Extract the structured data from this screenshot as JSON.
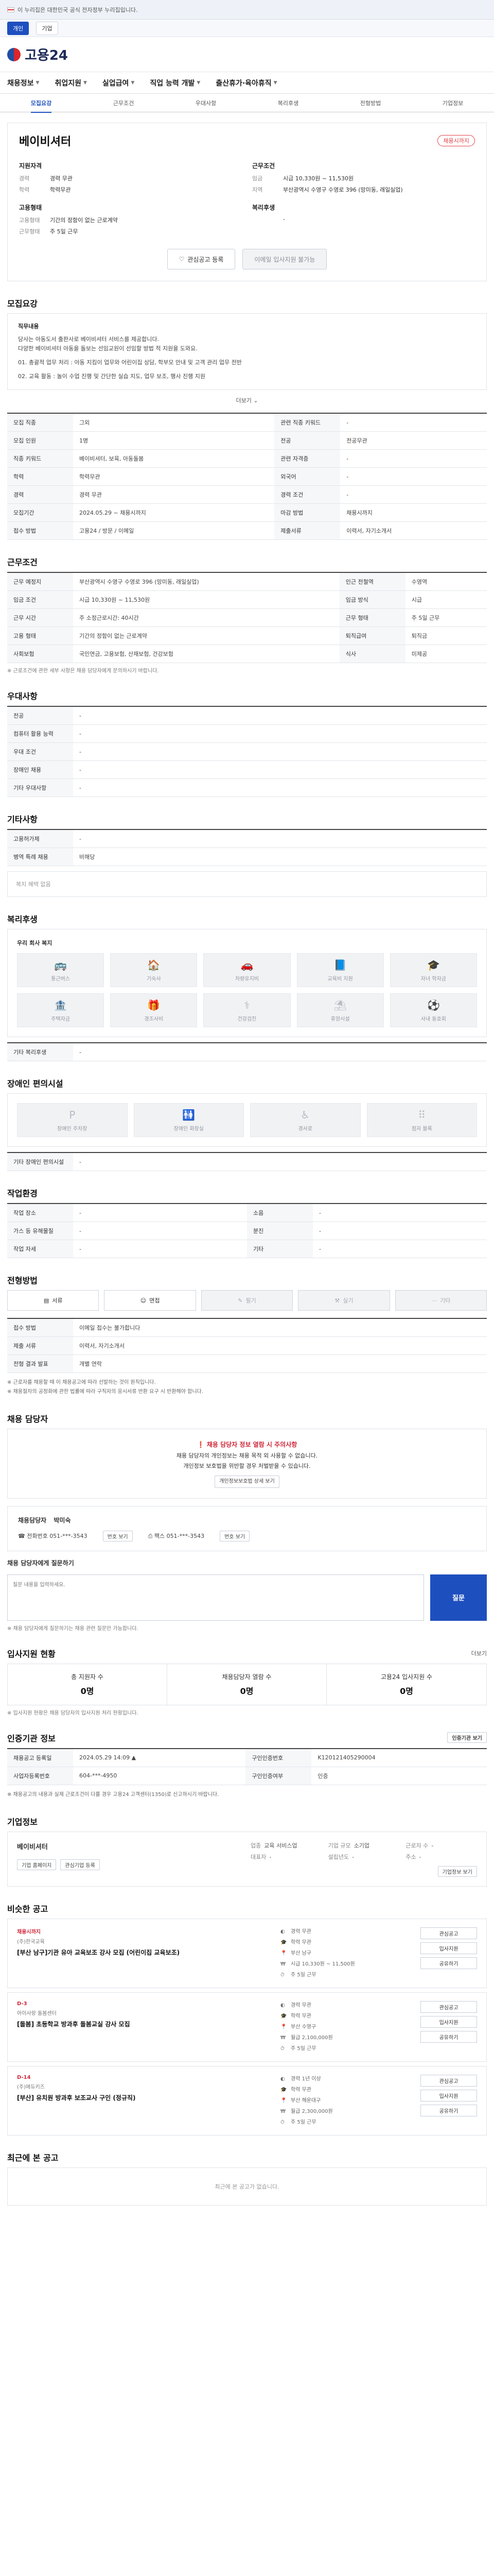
{
  "topbar": {
    "notice": "이 누리집은 대한민국 공식 전자정부 누리집입니다."
  },
  "sitebar": {
    "items": [
      "개인",
      "기업"
    ]
  },
  "logo": {
    "text": "고용24"
  },
  "gnb": {
    "items": [
      "채용정보",
      "취업지원",
      "실업급여",
      "직업 능력 개발",
      "출산휴가·육아휴직"
    ]
  },
  "tabs": {
    "items": [
      "모집요강",
      "근무조건",
      "우대사항",
      "복리후생",
      "전형방법",
      "기업정보"
    ],
    "active": 0
  },
  "company": {
    "name": "베이비셔터",
    "badge": "채용시까지",
    "left_title": "지원자격",
    "left": [
      {
        "k": "경력",
        "v": "경력 무관"
      },
      {
        "k": "학력",
        "v": "학력무관"
      }
    ],
    "left_title2": "고용형태",
    "left2": [
      {
        "k": "고용형태",
        "v": "기간의 정함이 없는 근로계약"
      },
      {
        "k": "근무형태",
        "v": "주 5일 근무"
      }
    ],
    "right_title": "근무조건",
    "right": [
      {
        "k": "임금",
        "v": "시급 10,330원 ~ 11,530원"
      },
      {
        "k": "지역",
        "v": "부산광역시 수영구 수영로 396 (망미동, 래일실업)"
      }
    ],
    "right_title2": "복리후생",
    "right2": [
      {
        "k": "",
        "v": "-"
      }
    ],
    "btn_save": "관심공고 등록",
    "btn_apply": "이메일 입사지원 불가능"
  },
  "recruit": {
    "section": "모집요강",
    "desc_title": "직무내용",
    "desc": [
      "당사는 아동도서 출판사로 베이비셔터 서비스를 제공합니다.",
      "다양한 베이비셔터 아동을 돌보는 선임교원이 선임할 방법 적 지원을 도와요.",
      "01. 총괄적 업무 처리 : 아동 지킴이 업무와 어린이집 상담, 학부모 안내 및 고객 관리 업무 전반",
      "02. 교육 활동 : 놀이 수업 진행 및 간단한 실습 지도, 업무 보조, 행사 진행 지원"
    ],
    "more": "더보기",
    "rows": [
      {
        "th": "모집 직종",
        "td": "그외",
        "th2": "관련 직종 키워드",
        "td2": "-"
      },
      {
        "th": "모집 인원",
        "td": "1명",
        "th2": "전공",
        "td2": "전공무관"
      },
      {
        "th": "직종 키워드",
        "td": "베이비셔터, 보육, 아동돌봄",
        "th2": "관련 자격증",
        "td2": "-"
      },
      {
        "th": "학력",
        "td": "학력무관",
        "th2": "외국어",
        "td2": "-"
      },
      {
        "th": "경력",
        "td": "경력 무관",
        "th2": "경력 조건",
        "td2": "-"
      },
      {
        "th": "모집기간",
        "td": "2024.05.29 ~ 채용시까지",
        "th2": "마감 방법",
        "td2": "채용시까지"
      },
      {
        "th": "접수 방법",
        "td": "고용24 / 방문 / 이메일",
        "th2": "제출서류",
        "td2": "이력서, 자기소개서"
      }
    ]
  },
  "condition": {
    "section": "근무조건",
    "rows": [
      {
        "th": "근무 예정지",
        "td": "부산광역시 수영구 수영로 396 (망미동, 래일실업)",
        "th2": "인근 전철역",
        "td2": "수영역"
      },
      {
        "th": "임금 조건",
        "td": "시급 10,330원 ~ 11,530원",
        "th2": "임금 방식",
        "td2": "시급"
      },
      {
        "th": "근무 시간",
        "td": "주 소정근로시간: 40시간",
        "th2": "근무 형태",
        "td2": "주 5일 근무"
      },
      {
        "th": "고용 형태",
        "td": "기간의 정함이 없는 근로계약",
        "th2": "퇴직급여",
        "td2": "퇴직금"
      },
      {
        "th": "사회보험",
        "td": "국민연금, 고용보험, 산재보험, 건강보험",
        "th2": "식사",
        "td2": "미제공"
      }
    ],
    "note": "※ 근로조건에 관한 세부 사항은 채용 담당자에게 문의하시기 바랍니다."
  },
  "preference": {
    "section": "우대사항",
    "rows": [
      {
        "th": "전공",
        "td": "-"
      },
      {
        "th": "컴퓨터 활용 능력",
        "td": "-"
      },
      {
        "th": "우대 조건",
        "td": "-"
      },
      {
        "th": "장애인 채용",
        "td": "-"
      },
      {
        "th": "기타 우대사항",
        "td": "-"
      }
    ]
  },
  "etc": {
    "section": "기타사항",
    "rows": [
      {
        "th": "고용허가제",
        "td": "-"
      },
      {
        "th": "병역 특례 채용",
        "td": "비해당"
      }
    ],
    "empty": "복지 혜택 없음"
  },
  "welfare": {
    "section": "복리후생",
    "cap": "우리 회사 복지",
    "items": [
      "통근버스",
      "기숙사",
      "차량유지비",
      "교육비 지원",
      "자녀 학자금",
      "주택자금",
      "경조사비",
      "건강검진",
      "휴양시설",
      "사내 동호회"
    ],
    "etc_label": "기타 복리후생",
    "etc_value": "-"
  },
  "disability": {
    "section": "장애인 편의시설",
    "items": [
      "장애인 주차장",
      "장애인 화장실",
      "경사로",
      "점자 블록"
    ],
    "etc_label": "기타 장애인 편의시설",
    "etc_value": "-"
  },
  "environment": {
    "section": "작업환경",
    "rows": [
      {
        "th": "작업 장소",
        "td": "-",
        "th2": "소음",
        "td2": "-"
      },
      {
        "th": "가스 등 유해물질",
        "td": "-",
        "th2": "분진",
        "td2": "-"
      },
      {
        "th": "작업 자세",
        "td": "-",
        "th2": "기타",
        "td2": "-"
      }
    ]
  },
  "method": {
    "section": "전형방법",
    "tiles": [
      "서류",
      "면접",
      "필기",
      "실기",
      "기타"
    ],
    "rows": [
      {
        "th": "접수 방법",
        "td": "이메일 접수는 불가합니다"
      },
      {
        "th": "제출 서류",
        "td": "이력서, 자기소개서"
      },
      {
        "th": "전형 결과 발표",
        "td": "개별 연락"
      }
    ],
    "bullets": [
      "※ 근로자를 채용할 때 이 채용공고에 따라 선발하는 것이 원칙입니다.",
      "※ 채용절차의 공정화에 관한 법률에 따라 구직자의 응시서류 반환 요구 시 반환해야 합니다."
    ]
  },
  "contact": {
    "section": "채용 담당자",
    "alert_title": "채용 담당자 정보 열람 시 주의사항",
    "alert_body": "채용 담당자의 개인정보는 채용 목적 외 사용할 수 없습니다.",
    "alert_body2": "개인정보 보호법을 위반할 경우 처벌받을 수 있습니다.",
    "alert_btn": "개인정보보호법 상세 보기",
    "name_label": "채용담당자",
    "name": "박미숙",
    "phone_label": "전화번호",
    "phone": "051-***-3543",
    "fax_label": "팩스",
    "fax": "051-***-3543",
    "view": "번호 보기",
    "q_label": "채용 담당자에게 질문하기",
    "q_hint": "※ 채용 담당자에게 질문하기는 채용 관련 질문만 가능합니다.",
    "q_placeholder": "질문 내용을 입력하세요.",
    "send": "질문"
  },
  "apply_status": {
    "section": "입사지원 현황",
    "link": "더보기",
    "stats": [
      {
        "label": "총 지원자 수",
        "value": "0명"
      },
      {
        "label": "채용담당자 열람 수",
        "value": "0명"
      },
      {
        "label": "고용24 입사지원 수",
        "value": "0명"
      }
    ],
    "note": "※ 입사지원 현황은 채용 담당자의 입사지원 처리 현황입니다."
  },
  "job_info": {
    "section": "인증기관 정보",
    "btn": "인증기관 보기",
    "rows": [
      {
        "th": "채용공고 등록일",
        "td": "2024.05.29 14:09 ▲",
        "th2": "구인인증번호",
        "td2": "K120121405290004"
      },
      {
        "th": "사업자등록번호",
        "td": "604-***-4950",
        "th2": "구인인증여부",
        "td2": "인증"
      }
    ],
    "bullets": [
      "※ 채용공고의 내용과 실제 근로조건이 다를 경우 고용24 고객센터(1350)로 신고하시기 바랍니다."
    ]
  },
  "corp": {
    "section": "기업정보",
    "name": "베이비셔터",
    "btn": "기업정보 보기",
    "items": [
      {
        "k": "업종",
        "v": "교육 서비스업"
      },
      {
        "k": "기업 규모",
        "v": "소기업"
      },
      {
        "k": "근로자 수",
        "v": "-"
      },
      {
        "k": "대표자",
        "v": "-"
      },
      {
        "k": "설립년도",
        "v": "-"
      },
      {
        "k": "주소",
        "v": "-"
      }
    ],
    "btn2": "기업 홈페이지",
    "btn3": "관심기업 등록"
  },
  "others": {
    "section": "비슷한 공고",
    "list": [
      {
        "deadline": "채용시까지",
        "comp": "(주)한국교육",
        "title": "[부산 남구]기관 유아 교육보조 강사 모집 (어린이집 교육보조)",
        "meta": [
          "경력 무관",
          "학력 무관",
          "부산 남구",
          "시급 10,330원 ~ 11,500원",
          "주 5일 근무"
        ]
      },
      {
        "deadline": "D-3",
        "comp": "아이사랑 돌봄센터",
        "title": "[돌봄] 초등학교 방과후 돌봄교실 강사 모집",
        "meta": [
          "경력 무관",
          "학력 무관",
          "부산 수영구",
          "월급 2,100,000원",
          "주 5일 근무"
        ]
      },
      {
        "deadline": "D-14",
        "comp": "(주)에듀키즈",
        "title": "[부산] 유치원 방과후 보조교사 구인 (정규직)",
        "meta": [
          "경력 1년 이상",
          "학력 무관",
          "부산 해운대구",
          "월급 2,300,000원",
          "주 5일 근무"
        ]
      }
    ],
    "btns": [
      "관심공고",
      "입사지원",
      "공유하기"
    ]
  },
  "footer": {
    "section": "최근에 본 공고",
    "empty": "최근에 본 공고가 없습니다."
  }
}
